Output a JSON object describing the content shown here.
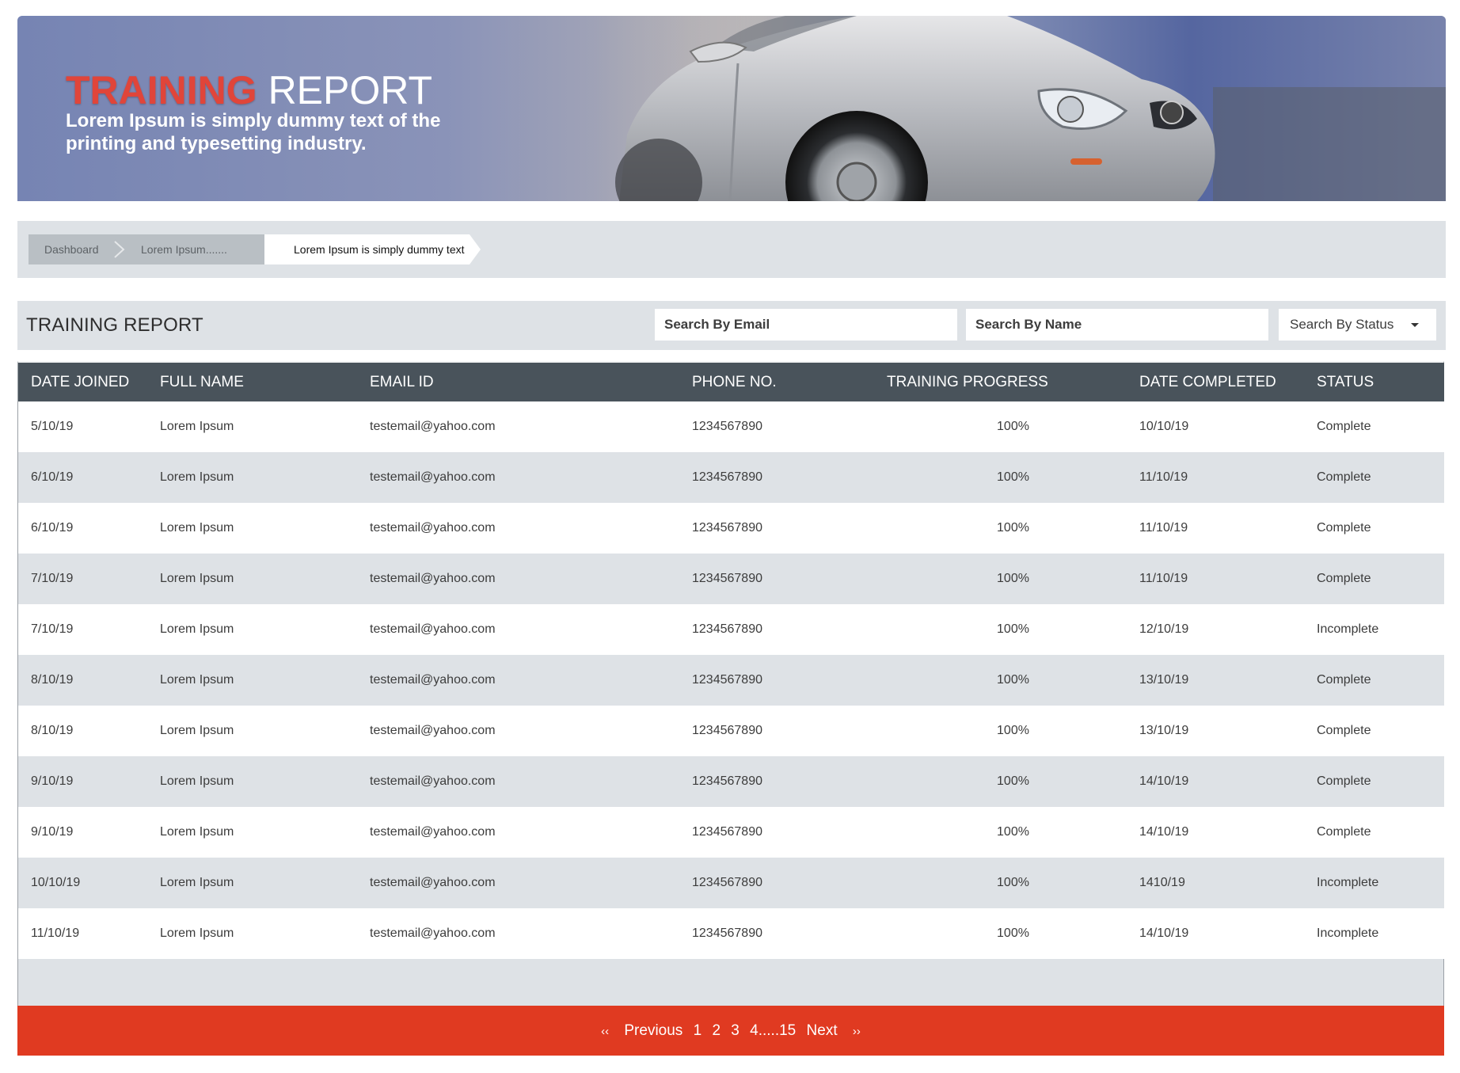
{
  "banner": {
    "title_accent": "TRAINING",
    "title_rest": "REPORT",
    "subtitle": "Lorem Ipsum is simply dummy text of the printing and typesetting industry."
  },
  "breadcrumb": {
    "items": [
      "Dashboard",
      "Lorem Ipsum.......",
      "Lorem Ipsum is simply dummy text"
    ]
  },
  "report": {
    "title": "TRAINING REPORT",
    "search_email_placeholder": "Search By Email",
    "search_name_placeholder": "Search By Name",
    "status_select_label": "Search By Status"
  },
  "table": {
    "columns": [
      "DATE JOINED",
      "FULL NAME",
      "EMAIL ID",
      "PHONE NO.",
      "TRAINING  PROGRESS",
      "DATE COMPLETED",
      "STATUS"
    ],
    "rows": [
      [
        "5/10/19",
        "Lorem Ipsum",
        "testemail@yahoo.com",
        "1234567890",
        "100%",
        "10/10/19",
        "Complete"
      ],
      [
        "6/10/19",
        "Lorem Ipsum",
        "testemail@yahoo.com",
        "1234567890",
        "100%",
        "11/10/19",
        "Complete"
      ],
      [
        "6/10/19",
        "Lorem Ipsum",
        "testemail@yahoo.com",
        "1234567890",
        "100%",
        "11/10/19",
        "Complete"
      ],
      [
        "7/10/19",
        "Lorem Ipsum",
        "testemail@yahoo.com",
        "1234567890",
        "100%",
        "11/10/19",
        "Complete"
      ],
      [
        "7/10/19",
        "Lorem Ipsum",
        "testemail@yahoo.com",
        "1234567890",
        "100%",
        "12/10/19",
        "Incomplete"
      ],
      [
        "8/10/19",
        "Lorem Ipsum",
        "testemail@yahoo.com",
        "1234567890",
        "100%",
        "13/10/19",
        "Complete"
      ],
      [
        "8/10/19",
        "Lorem Ipsum",
        "testemail@yahoo.com",
        "1234567890",
        "100%",
        "13/10/19",
        "Complete"
      ],
      [
        "9/10/19",
        "Lorem Ipsum",
        "testemail@yahoo.com",
        "1234567890",
        "100%",
        "14/10/19",
        "Complete"
      ],
      [
        "9/10/19",
        "Lorem Ipsum",
        "testemail@yahoo.com",
        "1234567890",
        "100%",
        "14/10/19",
        "Complete"
      ],
      [
        "10/10/19",
        "Lorem Ipsum",
        "testemail@yahoo.com",
        "1234567890",
        "100%",
        "1410/19",
        "Incomplete"
      ],
      [
        "11/10/19",
        "Lorem Ipsum",
        "testemail@yahoo.com",
        "1234567890",
        "100%",
        "14/10/19",
        "Incomplete"
      ]
    ]
  },
  "pagination": {
    "first": "‹‹",
    "previous": "Previous",
    "pages": [
      "1",
      "2",
      "3",
      "4.....15"
    ],
    "next": "Next",
    "last": "››"
  },
  "colors": {
    "accent_red": "#e03a21",
    "table_header": "#49535b",
    "panel_gray": "#dee2e6"
  },
  "icons": [
    "chevron-right-icon",
    "caret-down-icon",
    "double-chevron-left-icon",
    "double-chevron-right-icon"
  ]
}
